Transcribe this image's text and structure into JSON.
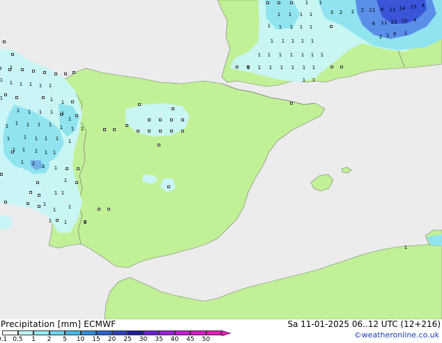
{
  "footer": {
    "title": "Precipitation [mm]  ECMWF",
    "datetime": "Sa 11-01-2025 06..12 UTC (12+216)",
    "credit": "©weatheronline.co.uk"
  },
  "legend": {
    "ticks": [
      "0.1",
      "0.5",
      "1",
      "2",
      "5",
      "10",
      "15",
      "20",
      "25",
      "30",
      "35",
      "40",
      "45",
      "50"
    ],
    "colors": [
      "#f5fdfd",
      "#c0f5f6",
      "#94ecf3",
      "#6cd4ee",
      "#46b8e6",
      "#2f8fd9",
      "#2a64cc",
      "#2a3fbd",
      "#1a1d9a",
      "#6b20d4",
      "#9a20d6",
      "#c41ad6",
      "#d91aca",
      "#e61ab6"
    ]
  },
  "map": {
    "colors": {
      "sea": "#ececec",
      "land": "#c2f097",
      "border": "#6f7a6f",
      "light_precip": "#c8f5f7",
      "moderate_precip": "#8fe4f0",
      "heavy_precip": "#5b8ee8",
      "very_heavy_precip": "#3a55d8"
    },
    "labels": [
      {
        "t": "1"
      },
      {
        "t": "1"
      },
      {
        "t": "1"
      },
      {
        "t": "1"
      },
      {
        "t": "1"
      },
      {
        "t": "1"
      },
      {
        "t": "1"
      },
      {
        "t": "1"
      },
      {
        "t": "1"
      },
      {
        "t": "1"
      },
      {
        "t": "1"
      },
      {
        "t": "1"
      },
      {
        "t": "1"
      },
      {
        "t": "1"
      },
      {
        "t": "1"
      },
      {
        "t": "1"
      },
      {
        "t": "1"
      },
      {
        "t": "1"
      },
      {
        "t": "1"
      },
      {
        "t": "1"
      },
      {
        "t": "1"
      },
      {
        "t": "1"
      },
      {
        "t": "1"
      },
      {
        "t": "1"
      },
      {
        "t": "1"
      },
      {
        "t": "1"
      },
      {
        "t": "1"
      },
      {
        "t": "1"
      },
      {
        "t": "1"
      },
      {
        "t": "1"
      },
      {
        "t": "1"
      },
      {
        "t": "1"
      },
      {
        "t": "1"
      },
      {
        "t": "1"
      },
      {
        "t": "1"
      },
      {
        "t": "1"
      },
      {
        "t": "1"
      },
      {
        "t": "1"
      },
      {
        "t": "1"
      },
      {
        "t": "1"
      },
      {
        "t": "1"
      },
      {
        "t": "1"
      },
      {
        "t": "1"
      },
      {
        "t": "1"
      },
      {
        "t": "1"
      },
      {
        "t": "1"
      },
      {
        "t": "1"
      },
      {
        "t": "1"
      },
      {
        "t": "1"
      },
      {
        "t": "1"
      },
      {
        "t": "1"
      },
      {
        "t": "1"
      },
      {
        "t": "1"
      },
      {
        "t": "1"
      },
      {
        "t": "1"
      },
      {
        "t": "1"
      },
      {
        "t": "1"
      },
      {
        "t": "1"
      },
      {
        "t": "1"
      },
      {
        "t": "1"
      },
      {
        "t": "3"
      },
      {
        "t": "2"
      },
      {
        "t": "2"
      },
      {
        "t": "2"
      },
      {
        "t": "11"
      },
      {
        "t": "8"
      },
      {
        "t": "13"
      },
      {
        "t": "14"
      },
      {
        "t": "15"
      },
      {
        "t": "4"
      },
      {
        "t": "6"
      },
      {
        "t": "11"
      },
      {
        "t": "13"
      },
      {
        "t": "10"
      },
      {
        "t": "4"
      },
      {
        "t": "2"
      },
      {
        "t": "1"
      },
      {
        "t": "9"
      },
      {
        "t": "1"
      },
      {
        "t": "1"
      },
      {
        "t": "3"
      },
      {
        "t": "2"
      },
      {
        "t": "1"
      },
      {
        "t": "1"
      },
      {
        "t": "1"
      },
      {
        "t": "1"
      },
      {
        "t": "1"
      },
      {
        "t": "1"
      },
      {
        "t": "1"
      },
      {
        "t": "1"
      },
      {
        "t": "1"
      },
      {
        "t": "1"
      },
      {
        "t": "1"
      },
      {
        "t": "1"
      },
      {
        "t": "1"
      },
      {
        "t": "1"
      },
      {
        "t": "1"
      },
      {
        "t": "1"
      },
      {
        "t": "1"
      },
      {
        "t": "1"
      }
    ]
  }
}
